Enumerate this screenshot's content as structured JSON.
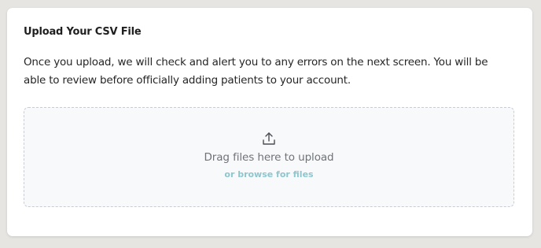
{
  "upload_card": {
    "title": "Upload Your CSV File",
    "description": "Once you upload, we will check and alert you to any errors on the next screen. You will be able to review before officially adding patients to your account.",
    "dropzone": {
      "icon": "upload-icon",
      "drag_text": "Drag files here to upload",
      "browse_text": "or browse for files"
    }
  },
  "colors": {
    "background": "#e6e5e2",
    "card": "#ffffff",
    "dropzone_bg": "#f8f9fb",
    "dropzone_border": "#c9cdd2",
    "link": "#8ec6ce"
  }
}
